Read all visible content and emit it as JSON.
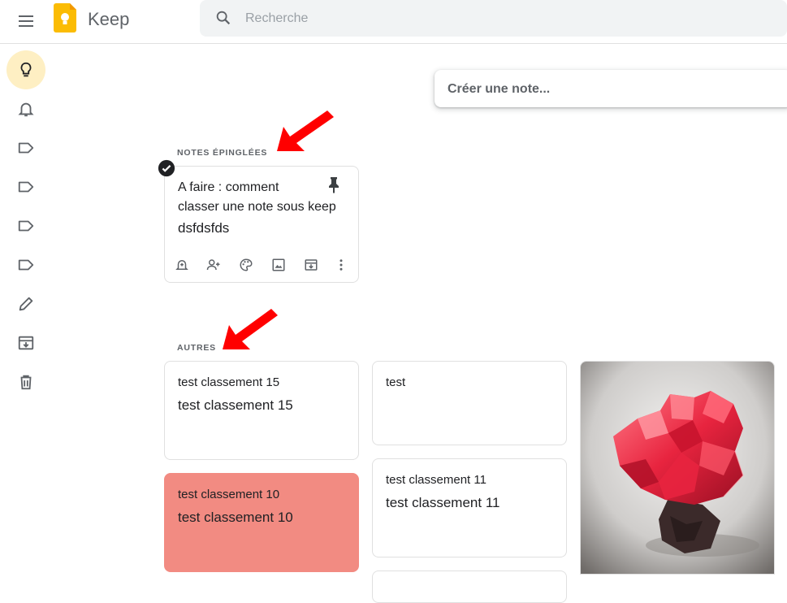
{
  "header": {
    "app_name": "Keep",
    "search_placeholder": "Recherche"
  },
  "sidebar": {
    "items": [
      {
        "icon": "lightbulb-icon",
        "label": "Notes",
        "active": true
      },
      {
        "icon": "bell-icon",
        "label": "Rappels"
      },
      {
        "icon": "label-icon",
        "label": "Libellé 1"
      },
      {
        "icon": "label-icon",
        "label": "Libellé 2"
      },
      {
        "icon": "label-icon",
        "label": "Libellé 3"
      },
      {
        "icon": "label-icon",
        "label": "Libellé 4"
      },
      {
        "icon": "pencil-icon",
        "label": "Modifier les libellés"
      },
      {
        "icon": "archive-icon",
        "label": "Archive"
      },
      {
        "icon": "trash-icon",
        "label": "Corbeille"
      }
    ]
  },
  "create_note": {
    "placeholder": "Créer une note..."
  },
  "sections": {
    "pinned": "NOTES ÉPINGLÉES",
    "others": "AUTRES"
  },
  "pinned_notes": [
    {
      "title_line1": "A faire : comment",
      "title_line2": "classer une note sous keep",
      "body": "dsfdsfds"
    }
  ],
  "other_notes": [
    {
      "title": "test classement 15",
      "body": "test classement 15"
    },
    {
      "title": "test",
      "body": ""
    },
    {
      "title": "test classement 10",
      "body": "test classement 10",
      "color": "#f28b82"
    },
    {
      "title": "test classement 11",
      "body": "test classement 11"
    }
  ],
  "colors": {
    "accent": "#fbbc04",
    "active_nav": "#feefc3",
    "red_note": "#f28b82",
    "annotation_arrow": "#ff0000"
  }
}
